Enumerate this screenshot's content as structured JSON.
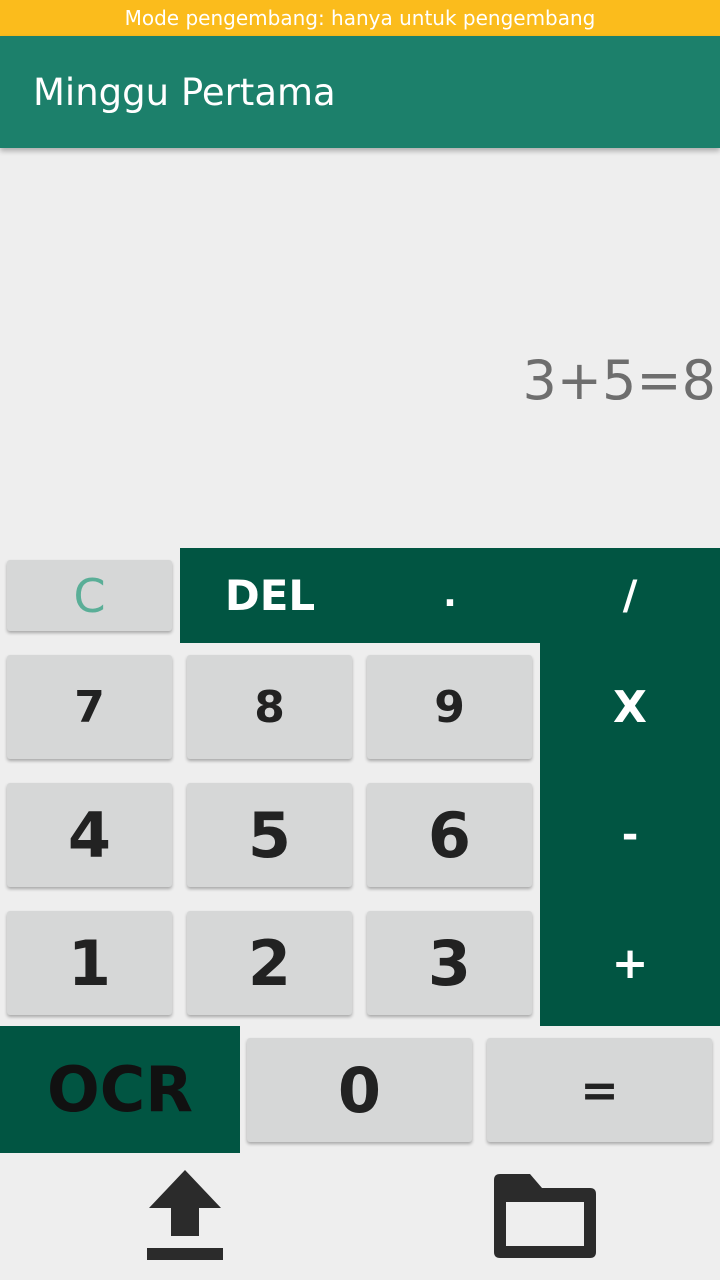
{
  "status_bar": {
    "dev_mode_text": "Mode pengembang: hanya untuk pengembang"
  },
  "app_bar": {
    "title": "Minggu Pertama"
  },
  "display": {
    "expression": "3+5=8"
  },
  "keys": {
    "clear": "C",
    "delete": "DEL",
    "dot": ".",
    "divide": "/",
    "multiply": "X",
    "minus": "-",
    "plus": "+",
    "seven": "7",
    "eight": "8",
    "nine": "9",
    "four": "4",
    "five": "5",
    "six": "6",
    "one": "1",
    "two": "2",
    "three": "3",
    "zero": "0",
    "equals": "=",
    "ocr": "OCR"
  },
  "bottom_bar": {
    "icons": [
      "upload-icon",
      "folder-icon"
    ]
  },
  "colors": {
    "banner": "#fbbc1c",
    "primary": "#1c806b",
    "operator_panel": "#015542",
    "key_background": "#d6d7d7",
    "clear_text": "#5aae97"
  }
}
